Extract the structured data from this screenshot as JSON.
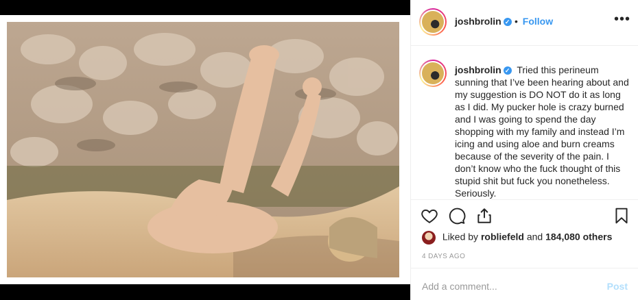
{
  "post": {
    "username": "joshbrolin",
    "follow_separator": "•",
    "follow_label": "Follow",
    "more_label": "•••",
    "caption": "Tried this perineum sunning that I’ve been hearing about and my suggestion is DO NOT do it as long as I did. My pucker hole is crazy burned and I was going to spend the day shopping with my family and instead I’m icing and using aloe and burn creams because of the severity of the pain. I don’t know who the fuck thought of this stupid shit but fuck you nonetheless. Seriously.",
    "liked_by_prefix": "Liked by",
    "liked_by_user": "robliefeld",
    "liked_by_and": "and",
    "liked_by_others": "184,080 others",
    "time_ago": "4 DAYS AGO",
    "comment_placeholder": "Add a comment...",
    "post_label": "Post"
  },
  "colors": {
    "accent": "#3897f0",
    "text": "#262626",
    "muted": "#999999"
  },
  "icons": [
    "heart-icon",
    "comment-icon",
    "share-icon",
    "bookmark-icon",
    "verified-icon"
  ]
}
